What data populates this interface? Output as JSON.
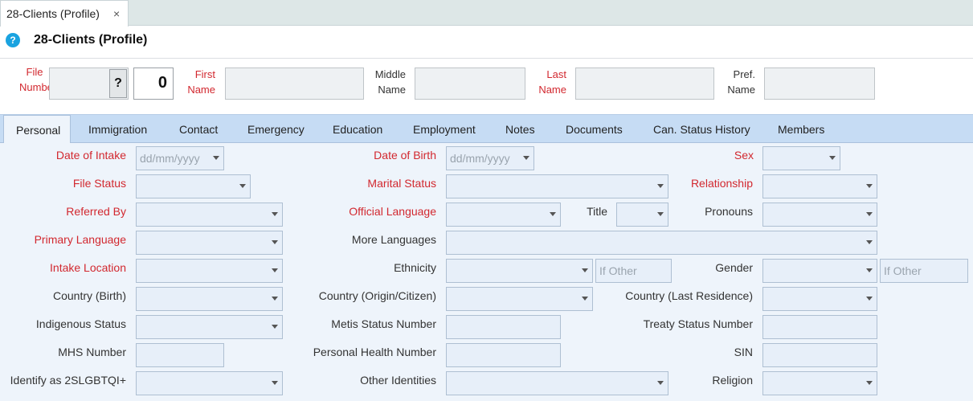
{
  "window": {
    "tab_label": "28-Clients (Profile)",
    "tab_close": "×",
    "help_glyph": "?",
    "title": "28-Clients (Profile)"
  },
  "header": {
    "file_number_line1": "File",
    "file_number_line2": "Number",
    "file_lookup_label": "?",
    "file_number_value": "0",
    "first_line1": "First",
    "first_line2": "Name",
    "middle_line1": "Middle",
    "middle_line2": "Name",
    "last_line1": "Last",
    "last_line2": "Name",
    "pref_line1": "Pref.",
    "pref_line2": "Name"
  },
  "tabs": [
    "Personal",
    "Immigration",
    "Contact",
    "Emergency",
    "Education",
    "Employment",
    "Notes",
    "Documents",
    "Can. Status History",
    "Members"
  ],
  "form": {
    "date_of_intake": "Date of Intake",
    "date_placeholder": "dd/mm/yyyy",
    "date_of_birth": "Date of Birth",
    "sex": "Sex",
    "file_status": "File Status",
    "marital_status": "Marital Status",
    "relationship": "Relationship",
    "referred_by": "Referred By",
    "official_language": "Official Language",
    "title": "Title",
    "pronouns": "Pronouns",
    "primary_language": "Primary Language",
    "more_languages": "More Languages",
    "intake_location": "Intake Location",
    "ethnicity": "Ethnicity",
    "if_other": "If Other",
    "gender": "Gender",
    "country_birth": "Country (Birth)",
    "country_origin": "Country (Origin/Citizen)",
    "country_last": "Country (Last Residence)",
    "indigenous_status": "Indigenous Status",
    "metis_status_number": "Metis Status Number",
    "treaty_status_number": "Treaty Status Number",
    "mhs_number": "MHS Number",
    "personal_health_number": "Personal Health Number",
    "sin": "SIN",
    "identify_2slgbtqi": "Identify as 2SLGBTQI+",
    "other_identities": "Other Identities",
    "religion": "Religion"
  }
}
